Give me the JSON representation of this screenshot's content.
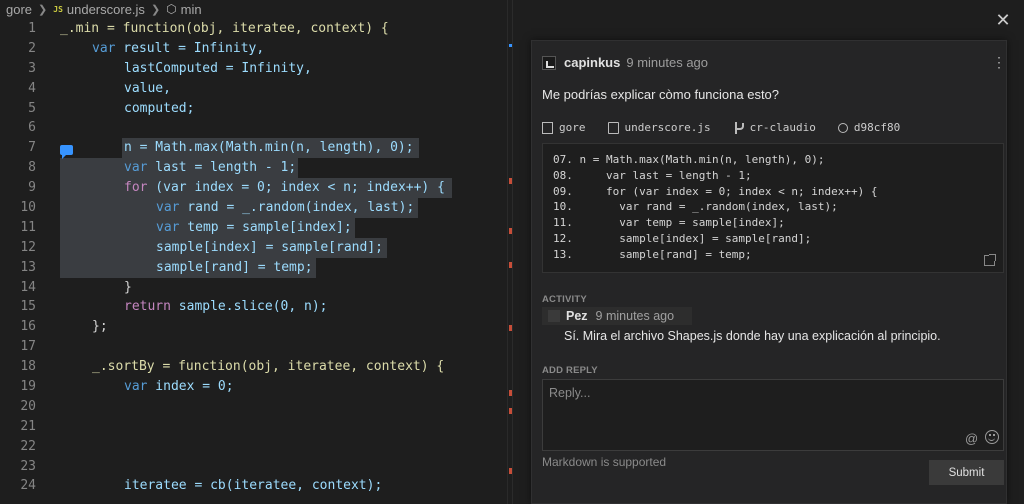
{
  "breadcrumb": {
    "folder": "gore",
    "file_badge": "JS",
    "file": "underscore.js",
    "symbol": "min"
  },
  "editor": {
    "lines": [
      {
        "n": "1"
      },
      {
        "n": "2"
      },
      {
        "n": "3"
      },
      {
        "n": "4"
      },
      {
        "n": "5"
      },
      {
        "n": "6"
      },
      {
        "n": "7"
      },
      {
        "n": "8"
      },
      {
        "n": "9"
      },
      {
        "n": "10"
      },
      {
        "n": "11"
      },
      {
        "n": "12"
      },
      {
        "n": "13"
      },
      {
        "n": "14"
      },
      {
        "n": "15"
      },
      {
        "n": "16"
      },
      {
        "n": "17"
      },
      {
        "n": "18"
      },
      {
        "n": "19"
      },
      {
        "n": "20"
      },
      {
        "n": "21"
      },
      {
        "n": "22"
      },
      {
        "n": "23"
      },
      {
        "n": "24"
      }
    ],
    "code": {
      "l1": "_.min = function(obj, iteratee, context) {",
      "l2_kw": "var",
      "l2_rest": " result = Infinity,",
      "l3": "lastComputed = Infinity,",
      "l4": "value,",
      "l5": "computed;",
      "l7": "n = Math.max(Math.min(n, length), 0);",
      "l8_kw": "var",
      "l8_rest": " last = length - 1;",
      "l9_kw": "for",
      "l9_rest": " (var index = 0; index < n; index++) {",
      "l10_kw": "var",
      "l10_rest": " rand = _.random(index, last);",
      "l11_kw": "var",
      "l11_rest": " temp = sample[index];",
      "l12": "sample[index] = sample[rand];",
      "l13": "sample[rand] = temp;",
      "l14": "}",
      "l15_kw": "return",
      "l15_rest": " sample.slice(0, n);",
      "l16": "};",
      "l18": "_.sortBy = function(obj, iteratee, context) {",
      "l19_kw": "var",
      "l19_rest": " index = 0;",
      "l24": "iteratee = cb(iteratee, context);"
    }
  },
  "comment": {
    "author": "capinkus",
    "time": "9 minutes ago",
    "question": "Me podrías explicar còmo funciona esto?",
    "meta": {
      "repo": "gore",
      "file": "underscore.js",
      "branch": "cr-claudio",
      "commit": "d98cf80"
    },
    "snippet": [
      "07. n = Math.max(Math.min(n, length), 0);",
      "08.     var last = length - 1;",
      "09.     for (var index = 0; index < n; index++) {",
      "10.       var rand = _.random(index, last);",
      "11.       var temp = sample[index];",
      "12.       sample[index] = sample[rand];",
      "13.       sample[rand] = temp;"
    ],
    "activity_label": "ACTIVITY",
    "reply_author": "Pez",
    "reply_time": "9 minutes ago",
    "reply_text": "Sí. Mira el archivo Shapes.js donde hay una explicación al principio.",
    "add_reply_label": "ADD REPLY",
    "reply_placeholder": "Reply...",
    "markdown_note": "Markdown is supported",
    "submit_label": "Submit"
  },
  "icons": {
    "close": "close-icon",
    "more": "more-vertical-icon",
    "mention": "at-icon",
    "emoji": "emoji-icon"
  },
  "colors": {
    "keyword": "#569cd6",
    "identifier": "#9cdcfe",
    "function": "#dcdcaa",
    "comment_glyph": "#3794ff",
    "ruler_mark": "#c74e39"
  }
}
